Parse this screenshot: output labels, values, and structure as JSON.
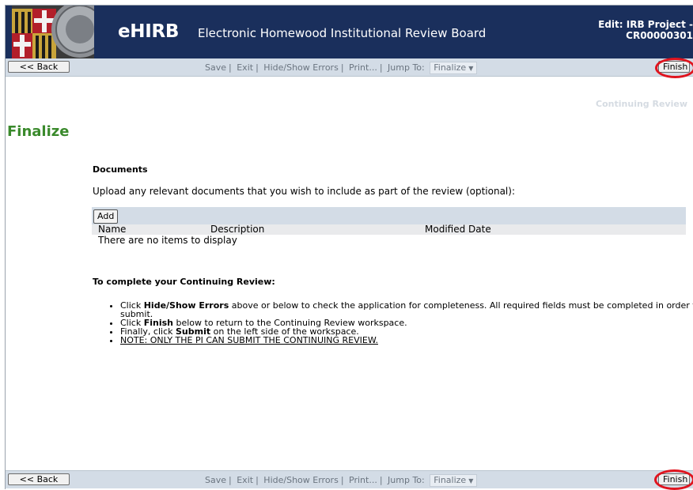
{
  "header": {
    "brand": "eHIRB",
    "subtitle": "Electronic Homewood Institutional Review Board",
    "edit_title_line1": "Edit: IRB Project -",
    "edit_title_line2": "CR00000301"
  },
  "toolbar": {
    "back_label": "<< Back",
    "save": "Save",
    "exit": "Exit",
    "hide_show_errors": "Hide/Show Errors",
    "print": "Print...",
    "jump_to": "Jump To:",
    "jump_value": "Finalize",
    "finish_label": "Finish",
    "separator": "|"
  },
  "page": {
    "breadcrumb": "Continuing Review",
    "title": "Finalize"
  },
  "documents": {
    "heading": "Documents",
    "intro": "Upload any relevant documents that you wish to include as part of the review (optional):",
    "add_label": "Add",
    "columns": [
      "Name",
      "Description",
      "Modified Date"
    ],
    "empty_text": "There are no items to display"
  },
  "instructions": {
    "heading": "To complete your Continuing Review:",
    "step1_pre": "Click ",
    "step1_bold": "Hide/Show Errors",
    "step1_post": " above or below to check the application for completeness.  All required fields must be completed in order to submit.",
    "step2_pre": "Click ",
    "step2_bold": "Finish",
    "step2_post": " below to return to the Continuing Review workspace.",
    "step3_pre": "Finally, click ",
    "step3_bold": "Submit",
    "step3_post": " on the left side of the workspace.",
    "step4": "NOTE: ONLY THE PI CAN SUBMIT THE CONTINUING REVIEW."
  },
  "colors": {
    "header_bg": "#1a2f5c",
    "toolbar_bg": "#d3dce6",
    "title_green": "#3a8a2c",
    "highlight_red": "#e0141e"
  }
}
